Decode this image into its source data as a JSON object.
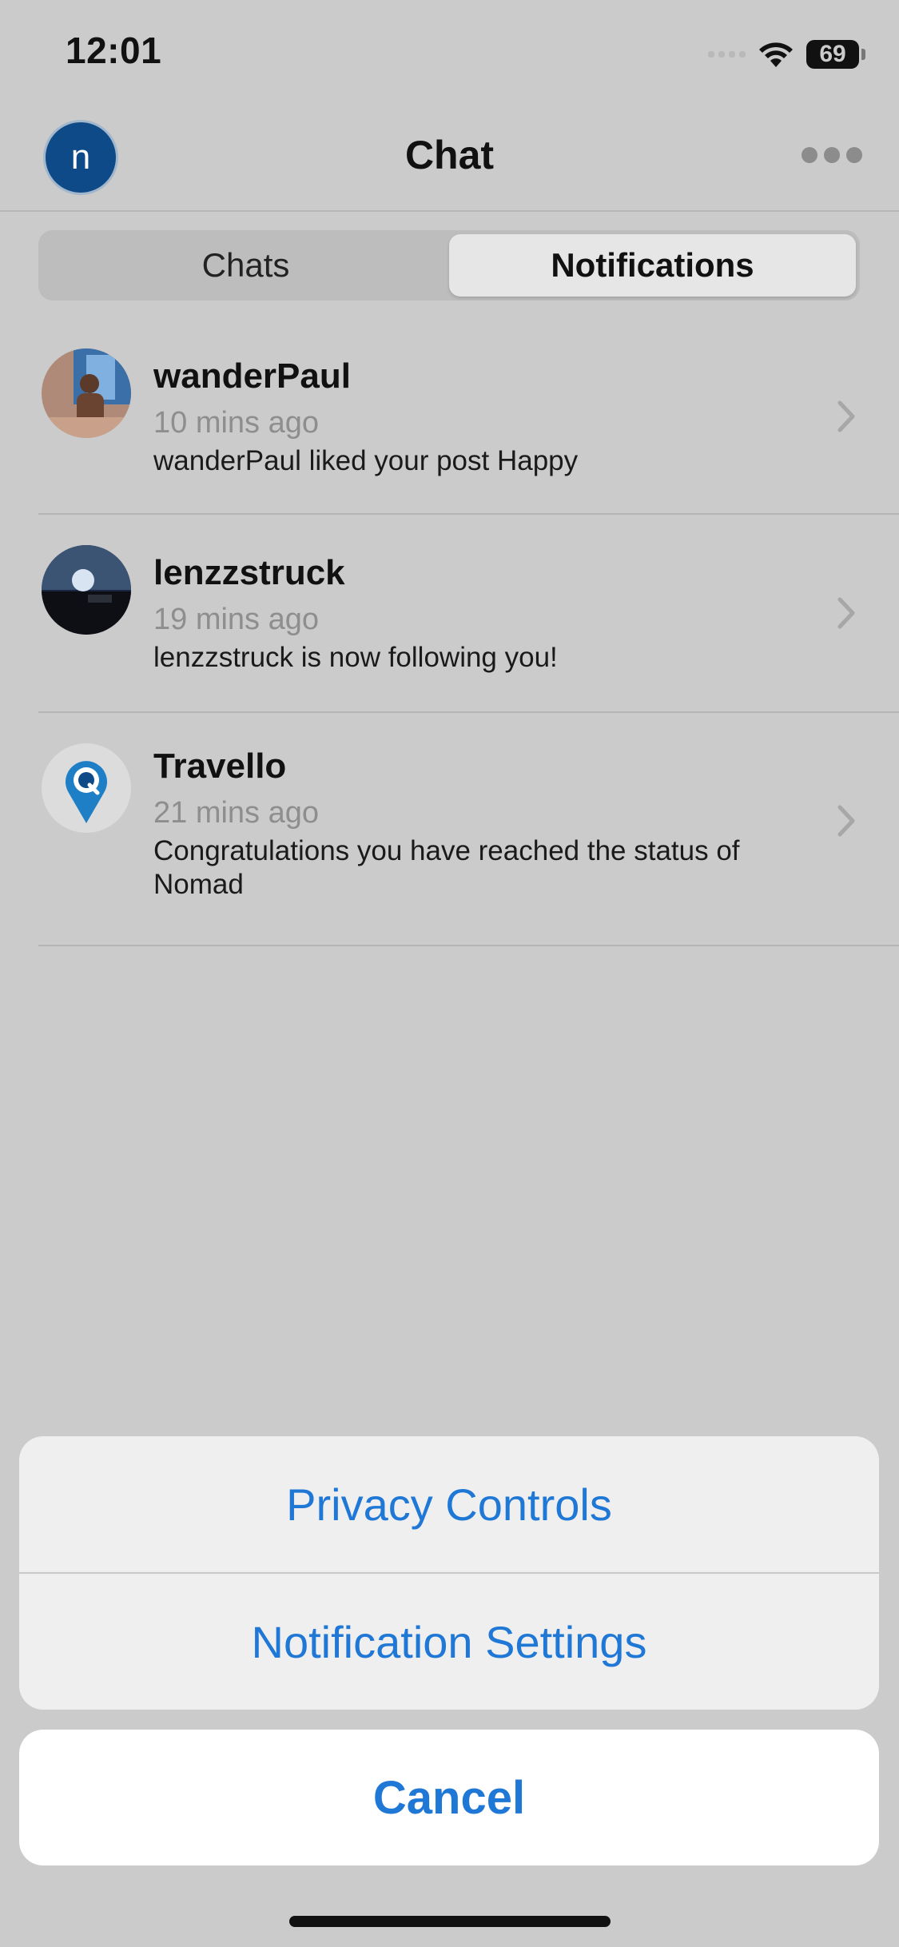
{
  "status_bar": {
    "time": "12:01",
    "battery": "69"
  },
  "header": {
    "avatar_letter": "n",
    "title": "Chat"
  },
  "tabs": [
    {
      "label": "Chats",
      "active": false
    },
    {
      "label": "Notifications",
      "active": true
    }
  ],
  "notifications": [
    {
      "name": "wanderPaul",
      "time": "10 mins ago",
      "message": "wanderPaul liked your post Happy",
      "avatar": "photo-avatar"
    },
    {
      "name": "lenzzstruck",
      "time": "19 mins ago",
      "message": "lenzzstruck is now following you!",
      "avatar": "photo-avatar"
    },
    {
      "name": "Travello",
      "time": "21 mins ago",
      "message": "Congratulations you have reached the status of Nomad",
      "avatar": "travello-logo-icon"
    }
  ],
  "action_sheet": {
    "privacy": "Privacy Controls",
    "settings": "Notification Settings",
    "cancel": "Cancel"
  },
  "colors": {
    "accent": "#1f77d6",
    "avatar_bg": "#0d4a87"
  }
}
